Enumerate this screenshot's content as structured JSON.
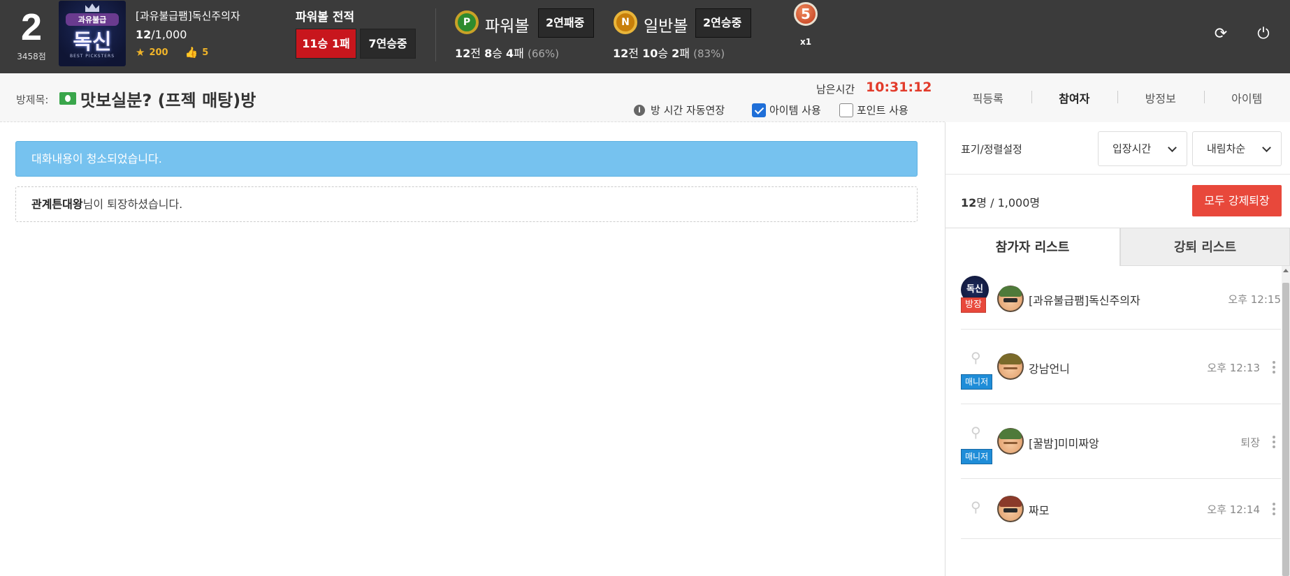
{
  "header": {
    "rank": "2",
    "points": "3458점",
    "logo": {
      "top": "과유불급",
      "main": "독신",
      "sub": "BEST PICKSTERS"
    },
    "user_name": "[과유불급팸]독신주의자",
    "user_count": "12",
    "user_count_total": "/1,000",
    "stars": "200",
    "likes": "5",
    "record_title": "파워볼 전적",
    "record_winloss": "11승 1패",
    "record_streak": "7연승중",
    "powerball": {
      "icon": "P",
      "name": "파워볼",
      "badge": "2연패중",
      "games": "12",
      "games_unit": "전 ",
      "wins": "8",
      "wins_unit": "승 ",
      "losses": "4",
      "losses_unit": "패 ",
      "pct": "(66%)"
    },
    "normalball": {
      "icon": "N",
      "name": "일반볼",
      "badge": "2연승중",
      "games": "12",
      "games_unit": "전 ",
      "wins": "10",
      "wins_unit": "승 ",
      "losses": "2",
      "losses_unit": "패 ",
      "pct": "(83%)"
    },
    "item": {
      "number": "5",
      "multiplier": "x1"
    }
  },
  "room": {
    "label": "방제목:",
    "title": "맛보실분? (프젝 매탕)방",
    "remain_label": "남은시간",
    "remain_time": "10:31:12",
    "auto_extend": "방 시간 자동연장",
    "item_use": "아이템 사용",
    "item_use_checked": true,
    "point_use": "포인트 사용",
    "point_use_checked": false
  },
  "right_tabs": [
    "픽등록",
    "참여자",
    "방정보",
    "아이템"
  ],
  "chat": {
    "notice": "대화내용이 청소되었습니다.",
    "leave_name": "관계튼대왕",
    "leave_text": "님이 퇴장하셨습니다."
  },
  "panel": {
    "sort_label": "표기/정렬설정",
    "sort_by": "입장시간",
    "sort_order": "내림차순",
    "count": "12",
    "count_unit": "명",
    "count_total": " / 1,000명",
    "kick_all": "모두 강제퇴장",
    "tab_participants": "참가자 리스트",
    "tab_kicked": "강퇴 리스트",
    "participants": [
      {
        "name": "[과유불급팸]독신주의자",
        "time": "오후 12:15",
        "role": "방장",
        "badge_text": "독신",
        "cap_color": "#4e7a3a"
      },
      {
        "name": "강남언니",
        "time": "오후 12:13",
        "role": "매니저",
        "cap_color": "#7a6a2a"
      },
      {
        "name": "[꿀밤]미미짜앙",
        "time": "퇴장",
        "role": "매니저",
        "cap_color": "#4e7a3a"
      },
      {
        "name": "짜모",
        "time": "오후 12:14",
        "role": "",
        "cap_color": "#8a3a2a"
      }
    ]
  }
}
